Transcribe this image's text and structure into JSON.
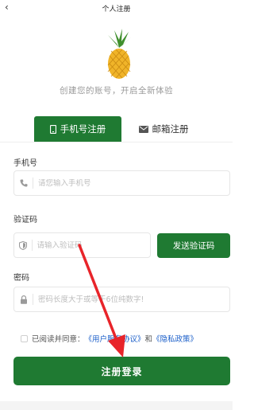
{
  "nav": {
    "back_icon": "chevron-left-icon",
    "back_glyph": "‹",
    "title": "个人注册"
  },
  "hero": {
    "logo_icon": "pineapple-icon",
    "subtitle": "创建您的账号，开启全新体验"
  },
  "tabs": [
    {
      "label": "手机号注册",
      "icon": "phone-icon",
      "active": true
    },
    {
      "label": "邮箱注册",
      "icon": "mail-icon",
      "active": false
    }
  ],
  "form": {
    "phone": {
      "label": "手机号",
      "placeholder": "请您输入手机号",
      "value": ""
    },
    "code": {
      "label": "验证码",
      "placeholder": "请输入验证码",
      "value": ""
    },
    "send_code_label": "发送验证码",
    "password": {
      "label": "密码",
      "placeholder": "密码长度大于或等于6位纯数字!",
      "value": ""
    }
  },
  "agreement": {
    "prefix": "已阅读并同意：",
    "link1": "《用户服务协议》",
    "conj": "和",
    "link2": "《隐私政策》",
    "checked": false
  },
  "submit_label": "注册登录",
  "colors": {
    "primary": "#1f7a32",
    "link": "#1a5ec9",
    "arrow": "#e8242a"
  }
}
